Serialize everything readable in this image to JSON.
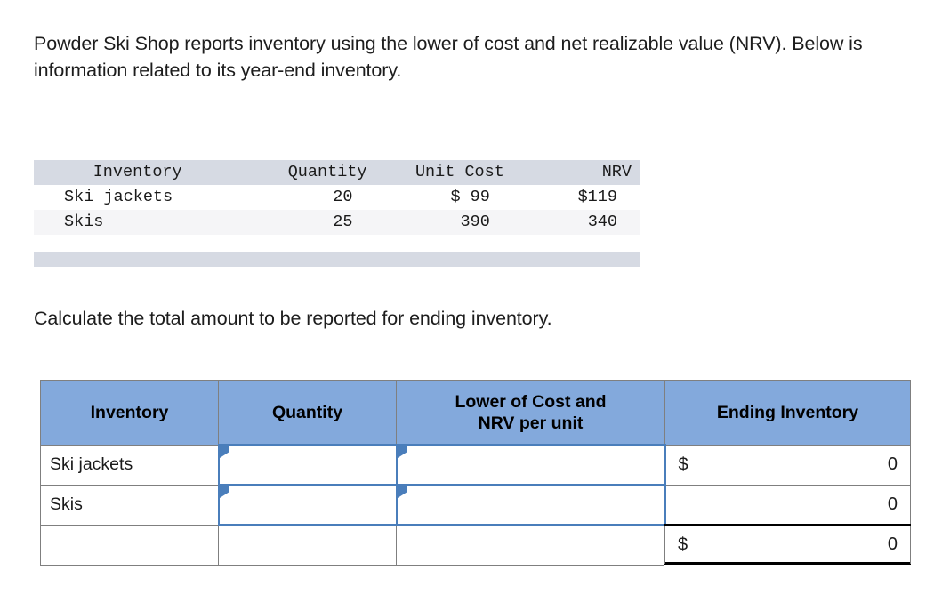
{
  "intro": {
    "text": "Powder Ski Shop reports inventory using the lower of cost and net realizable value (NRV). Below is information related to its year-end inventory."
  },
  "question": {
    "text": "Calculate the total amount to be reported for ending inventory."
  },
  "given_data_table": {
    "columns": [
      "Inventory",
      "Quantity",
      "Unit Cost",
      "NRV"
    ],
    "rows": [
      {
        "inventory": "Ski jackets",
        "quantity": "20",
        "unit_cost": "$ 99",
        "nrv": "$119"
      },
      {
        "inventory": "Skis",
        "quantity": "25",
        "unit_cost": "390",
        "nrv": "340"
      }
    ]
  },
  "answer_table": {
    "columns": [
      "Inventory",
      "Quantity",
      "Lower of Cost and NRV per unit",
      "Ending Inventory"
    ],
    "column_header_lines": {
      "lower_of_cost_line1": "Lower of Cost and",
      "lower_of_cost_line2": "NRV per unit"
    },
    "rows": [
      {
        "inventory": "Ski jackets",
        "quantity": "",
        "lower_of_cost_nrv": "",
        "ending_inventory_sign": "$",
        "ending_inventory_value": "0"
      },
      {
        "inventory": "Skis",
        "quantity": "",
        "lower_of_cost_nrv": "",
        "ending_inventory_sign": "",
        "ending_inventory_value": "0"
      },
      {
        "inventory": "",
        "quantity": "",
        "lower_of_cost_nrv": "",
        "ending_inventory_sign": "$",
        "ending_inventory_value": "0"
      }
    ]
  },
  "colors": {
    "header_blue": "#83a9dc",
    "input_border_blue": "#4a7ebb",
    "data_header_gray": "#d6dae3",
    "stripe_gray": "#f5f5f7",
    "table_border_gray": "#7f7f7f"
  }
}
